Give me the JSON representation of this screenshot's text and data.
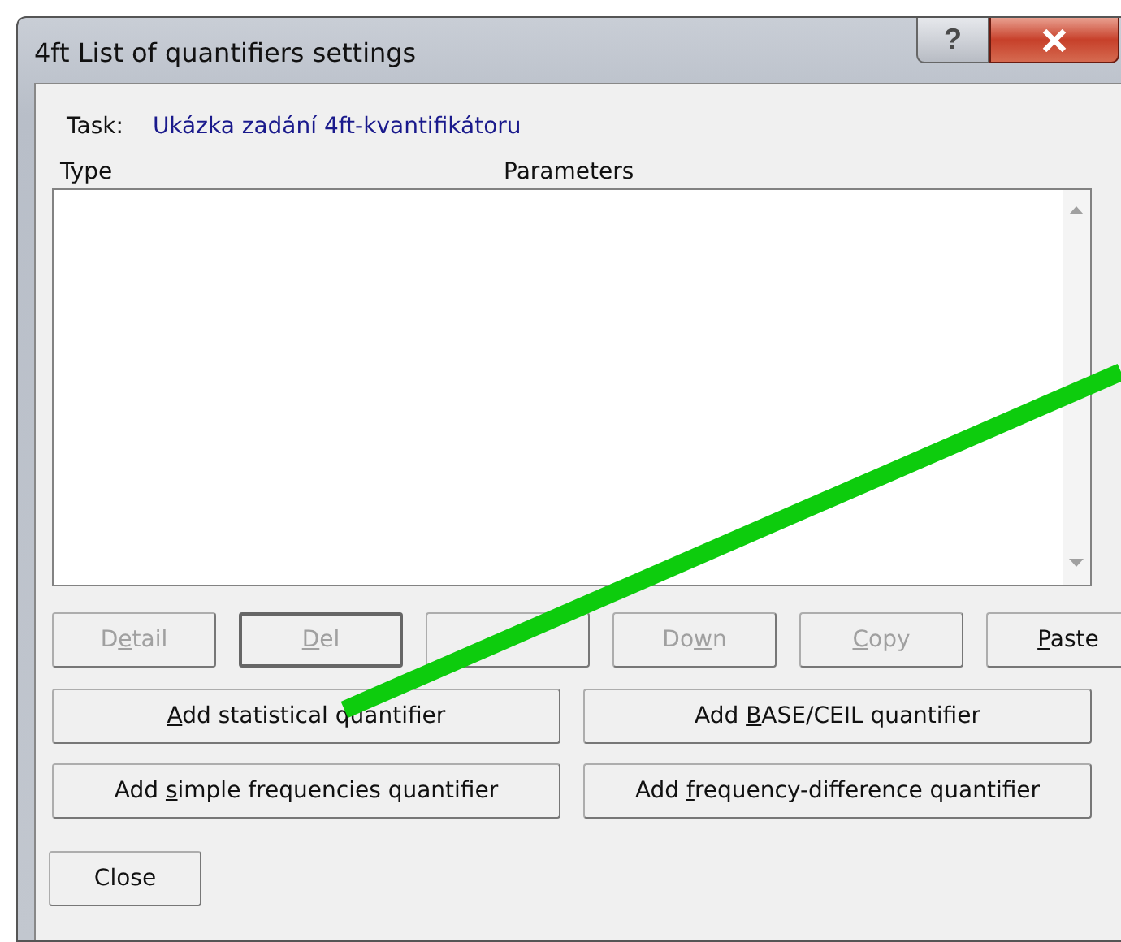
{
  "window": {
    "title": "4ft List of quantifiers settings",
    "controls": [
      {
        "kind": "help",
        "label": "?"
      },
      {
        "kind": "close"
      }
    ]
  },
  "task": {
    "label": "Task:",
    "value": "Ukázka zadání 4ft-kvantifikátoru"
  },
  "list": {
    "columns": [
      "Type",
      "Parameters"
    ]
  },
  "row_buttons": [
    {
      "kind": "text",
      "pre": "D",
      "key": "e",
      "post": "tail",
      "disabled": true,
      "focused": false
    },
    {
      "kind": "text",
      "key": "D",
      "post": "el",
      "disabled": true,
      "focused": true
    },
    {
      "kind": "covered"
    },
    {
      "kind": "text",
      "pre": "Do",
      "key": "w",
      "post": "n",
      "disabled": true,
      "focused": false
    },
    {
      "kind": "text",
      "key": "C",
      "post": "opy",
      "disabled": true,
      "focused": false
    },
    {
      "kind": "text",
      "key": "P",
      "post": "aste",
      "disabled": false,
      "focused": false
    }
  ],
  "add_buttons": [
    {
      "key": "A",
      "post": "dd statistical quantifier"
    },
    {
      "pre": "Add ",
      "key": "B",
      "post": "ASE/CEIL quantifier"
    },
    {
      "pre": "Add ",
      "key": "s",
      "post": "imple frequencies quantifier"
    },
    {
      "pre": "Add ",
      "key": "f",
      "post": "requency-difference quantifier"
    }
  ],
  "close_button": {
    "label": "Close"
  }
}
